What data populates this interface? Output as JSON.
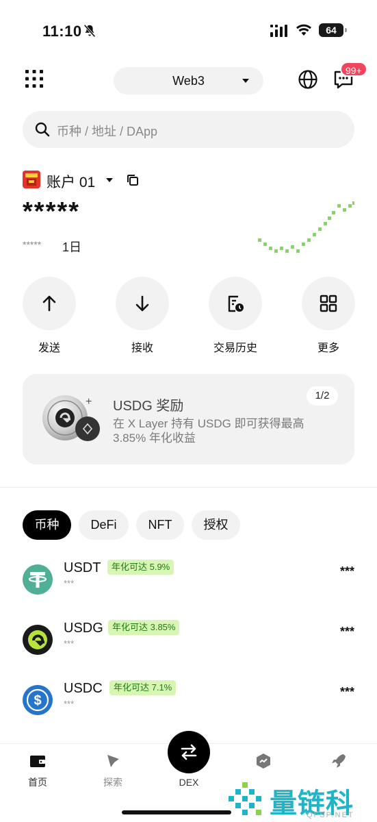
{
  "status_bar": {
    "time": "11:10",
    "battery": "64"
  },
  "header": {
    "network": "Web3",
    "badge": "99+"
  },
  "search": {
    "placeholder": "币种 / 地址 / DApp"
  },
  "account": {
    "name": "账户 01",
    "balance": "*****",
    "change": "*****",
    "period": "1日"
  },
  "actions": [
    {
      "label": "发送",
      "icon": "arrow-up-icon"
    },
    {
      "label": "接收",
      "icon": "arrow-down-icon"
    },
    {
      "label": "交易历史",
      "icon": "history-icon"
    },
    {
      "label": "更多",
      "icon": "grid-icon"
    }
  ],
  "promo": {
    "title": "USDG 奖励",
    "description": "在 X Layer 持有 USDG 即可获得最高 3.85% 年化收益",
    "pager": "1/2"
  },
  "tabs": [
    "币种",
    "DeFi",
    "NFT",
    "授权"
  ],
  "tokens": [
    {
      "symbol": "USDT",
      "apy": "年化可达 5.9%",
      "sub": "***",
      "amount": "***",
      "color": "#50af95"
    },
    {
      "symbol": "USDG",
      "apy": "年化可达 3.85%",
      "sub": "***",
      "amount": "***",
      "color": "#1a1a1a"
    },
    {
      "symbol": "USDC",
      "apy": "年化可达 7.1%",
      "sub": "***",
      "amount": "***",
      "color": "#2775ca"
    }
  ],
  "bottom_nav": {
    "home": "首页",
    "discover": "探索",
    "dex": "DEX"
  },
  "watermark": {
    "text": "量链科技",
    "url": "QFSP.NET"
  },
  "colors": {
    "accent_badge": "#f0455c",
    "apy_bg": "#d7f6b4",
    "apy_text": "#1f7a13",
    "spark": "#8ad36b",
    "watermark": "#1fb5c9"
  }
}
